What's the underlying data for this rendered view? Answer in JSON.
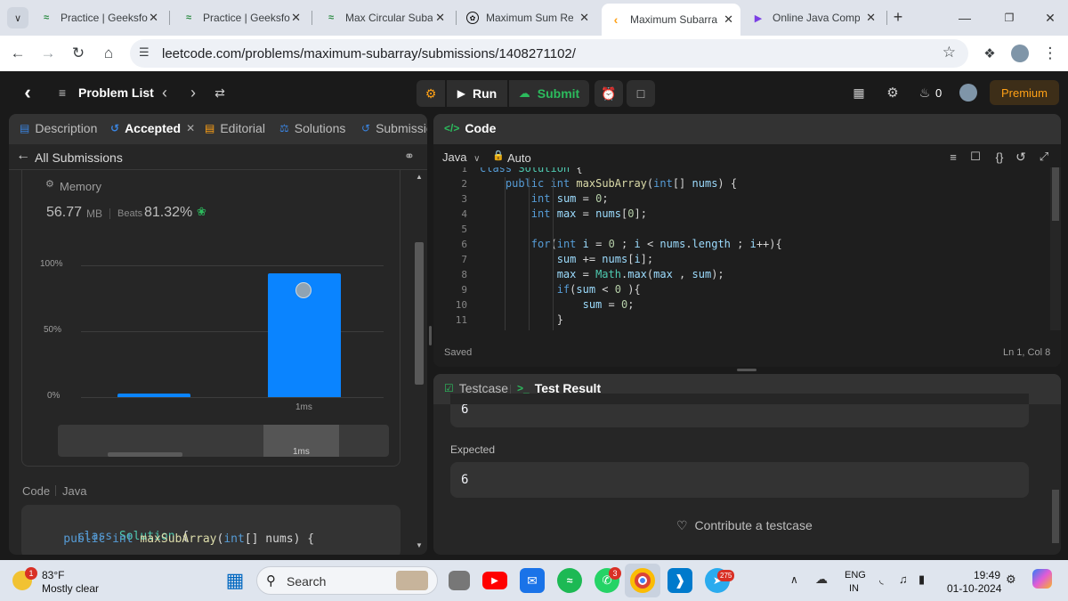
{
  "browser": {
    "tabs": [
      {
        "title": "Practice | GeeksforGeeks",
        "icon": "gfg-icon"
      },
      {
        "title": "Practice | GeeksforGeeks",
        "icon": "gfg-icon"
      },
      {
        "title": "Max Circular Subarray",
        "icon": "gfg-icon"
      },
      {
        "title": "Maximum Sum Rectangle",
        "icon": "chatgpt-icon"
      },
      {
        "title": "Maximum Subarray",
        "icon": "leetcode-icon",
        "active": true
      },
      {
        "title": "Online Java Compiler",
        "icon": "compiler-icon"
      }
    ],
    "url": "leetcode.com/problems/maximum-subarray/submissions/1408271102/"
  },
  "header": {
    "problem_list": "Problem List",
    "run": "Run",
    "submit": "Submit",
    "streak": "0",
    "premium": "Premium"
  },
  "left_panel": {
    "tabs": [
      "Description",
      "Accepted",
      "Editorial",
      "Solutions",
      "Submissions"
    ],
    "all_submissions": "All Submissions",
    "memory_label": "Memory",
    "memory_value": "56.77",
    "memory_unit": "MB",
    "beats_label": "Beats",
    "beats_value": "81.32%",
    "code_label": "Code",
    "code_lang": "Java",
    "code_preview": [
      "class Solution {",
      "    public int maxSubArray(int[] nums) {"
    ]
  },
  "chart_data": {
    "type": "bar",
    "categories": [
      "",
      "1ms"
    ],
    "values": [
      3,
      94
    ],
    "yticks": [
      "100%",
      "50%",
      "0%"
    ],
    "ylim": [
      0,
      100
    ],
    "xlabel": "1ms",
    "mini_label": "1ms",
    "colors": {
      "bar": "#0a84ff"
    }
  },
  "editor": {
    "title": "Code",
    "language": "Java",
    "mode": "Auto",
    "status": "Saved",
    "cursor": "Ln 1, Col 8",
    "lines": [
      {
        "n": "1",
        "text": "class Solution {"
      },
      {
        "n": "2",
        "text": "    public int maxSubArray(int[] nums) {"
      },
      {
        "n": "3",
        "text": "        int sum = 0;"
      },
      {
        "n": "4",
        "text": "        int max = nums[0];"
      },
      {
        "n": "5",
        "text": ""
      },
      {
        "n": "6",
        "text": "        for(int i = 0 ; i < nums.length ; i++){"
      },
      {
        "n": "7",
        "text": "            sum += nums[i];"
      },
      {
        "n": "8",
        "text": "            max = Math.max(max , sum);"
      },
      {
        "n": "9",
        "text": "            if(sum < 0 ){"
      },
      {
        "n": "10",
        "text": "                sum = 0;"
      },
      {
        "n": "11",
        "text": "            }"
      }
    ]
  },
  "result_panel": {
    "tab_testcase": "Testcase",
    "tab_result": "Test Result",
    "output_value": "6",
    "expected_label": "Expected",
    "expected_value": "6",
    "contribute": "Contribute a testcase"
  },
  "taskbar": {
    "temp": "83°F",
    "weather": "Mostly clear",
    "weather_badge": "1",
    "search": "Search",
    "lang_line1": "ENG",
    "lang_line2": "IN",
    "time": "19:49",
    "date": "01-10-2024",
    "whatsapp_badge": "3",
    "telegram_badge": "275"
  }
}
